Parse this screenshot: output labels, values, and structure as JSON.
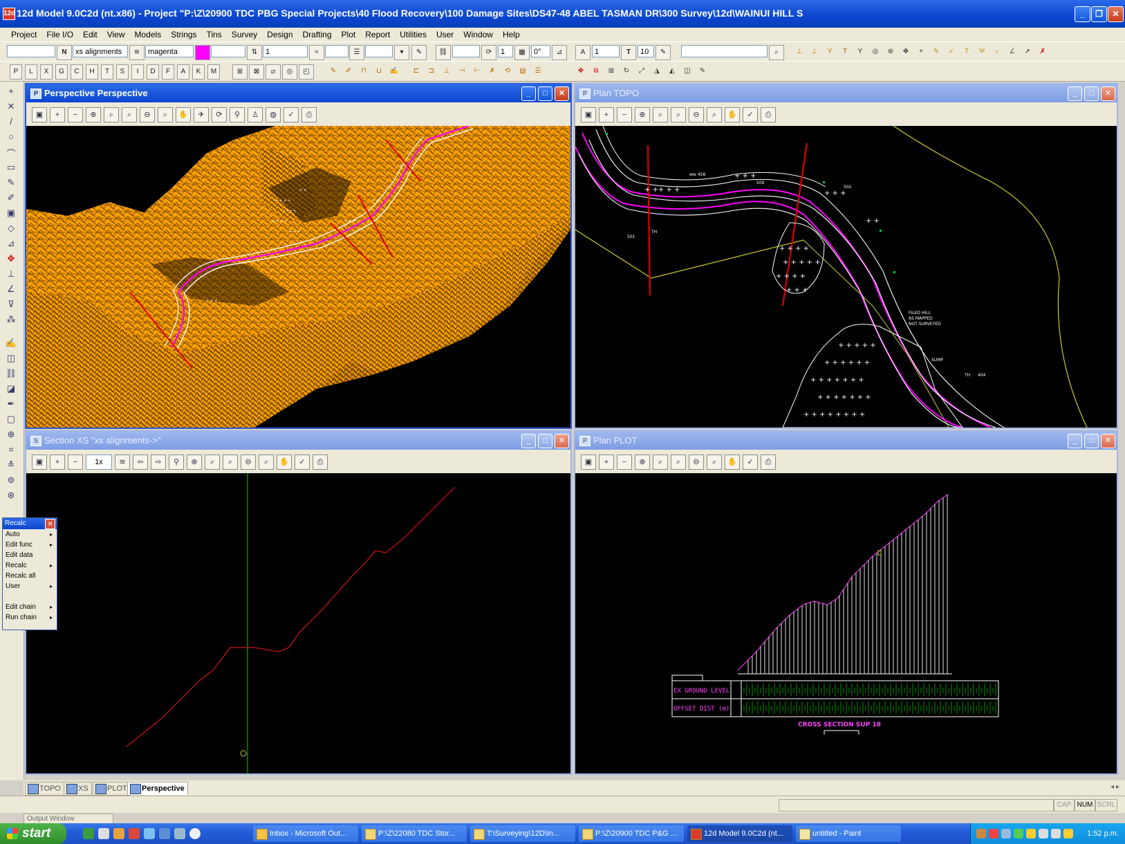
{
  "window": {
    "app_icon": "12d",
    "title": "12d Model 9.0C2d (nt.x86) - Project \"P:\\Z\\20900 TDC PBG Special Projects\\40 Flood Recovery\\100 Damage Sites\\DS47-48 ABEL TASMAN DR\\300 Survey\\12d\\WAINUI HILL S",
    "minimize": "_",
    "restore": "❐",
    "close": "✕"
  },
  "menu": [
    "Project",
    "File I/O",
    "Edit",
    "View",
    "Models",
    "Strings",
    "Tins",
    "Survey",
    "Design",
    "Drafting",
    "Plot",
    "Report",
    "Utilities",
    "User",
    "Window",
    "Help"
  ],
  "toolbar1": {
    "n_label": "N",
    "model_value": "xs alignments",
    "colour_value": "magenta",
    "colour_swatch": "#ff00ff",
    "weight_value": "1",
    "count_value": "1",
    "angle_value": "0°",
    "text_value": "1",
    "text_size_value": "10",
    "t_label": "T"
  },
  "toolbar2": {
    "letters": [
      "P",
      "L",
      "X",
      "G",
      "C",
      "H",
      "T",
      "S",
      "I",
      "D",
      "F",
      "A",
      "K",
      "M"
    ]
  },
  "left_tools": [
    "+",
    "✕",
    "/",
    "○",
    "⌒",
    "▭",
    "✎",
    "✐",
    "▣",
    "◇",
    "⊿",
    "✥",
    "⊥",
    "∠",
    "⊽",
    "⁂",
    "✍",
    "◫",
    "⛓",
    "◪",
    "✒",
    "▢",
    "⊕",
    "⌗",
    "≛",
    "⊚",
    "⊛"
  ],
  "windows": {
    "perspective": {
      "title": "Perspective Perspective",
      "icon": "P"
    },
    "topo": {
      "title": "Plan TOPO",
      "icon": "P"
    },
    "xs": {
      "title": "Section XS \"xs alignments->\"",
      "icon": "S",
      "zoom": "1x"
    },
    "plot": {
      "title": "Plan PLOT",
      "icon": "P"
    }
  },
  "topo_labels": {
    "l1": "ww 458",
    "l2": "500",
    "l3": "502",
    "l4": "TH",
    "l5": "501",
    "l6": "FILED HILL",
    "l7": "AS MAPPED",
    "l8": "NOT SURVEYED",
    "l9": "SUMP",
    "l10": "TH",
    "l11": "404"
  },
  "plot_labels": {
    "ground": "EX GROUND LEVEL",
    "offset": "OFFSET DIST (m)",
    "title": "CROSS SECTION SUP 18"
  },
  "colors": {
    "terrain": "#ffa000",
    "road": "#ff00ff",
    "survey": "#ffffff",
    "boundary": "#cccc33",
    "section": "#cc0000",
    "xsline": "#00aa00",
    "xs_profile": "#aa1111",
    "plot_grid": "#00bb00"
  },
  "recalc": {
    "title": "Recalc",
    "items": [
      {
        "label": "Auto",
        "sub": "▸"
      },
      {
        "label": "Edit func",
        "sub": "▸"
      },
      {
        "label": "Edit data",
        "sub": ""
      },
      {
        "label": "Recalc",
        "sub": "▸"
      },
      {
        "label": "Recalc all",
        "sub": ""
      },
      {
        "label": "User",
        "sub": "▸"
      },
      {
        "label": "",
        "sub": ""
      },
      {
        "label": "Edit chain",
        "sub": "▸"
      },
      {
        "label": "Run chain",
        "sub": "▸"
      }
    ]
  },
  "tabs": [
    "TOPO",
    "XS",
    "PLOT",
    "Perspective"
  ],
  "status": {
    "caps": "CAP",
    "num": "NUM",
    "scrl": "SCRL",
    "output_window": "Output Window"
  },
  "taskbar": {
    "start": "start",
    "tasks": [
      "Inbox - Microsoft Out...",
      "P:\\Z\\22080 TDC Stor...",
      "T:\\Surveying\\12D\\In...",
      "P:\\Z\\20900 TDC P&G ...",
      "12d Model 9.0C2d (nt...",
      "untitled - Paint"
    ],
    "clock": "1:52 p.m."
  }
}
